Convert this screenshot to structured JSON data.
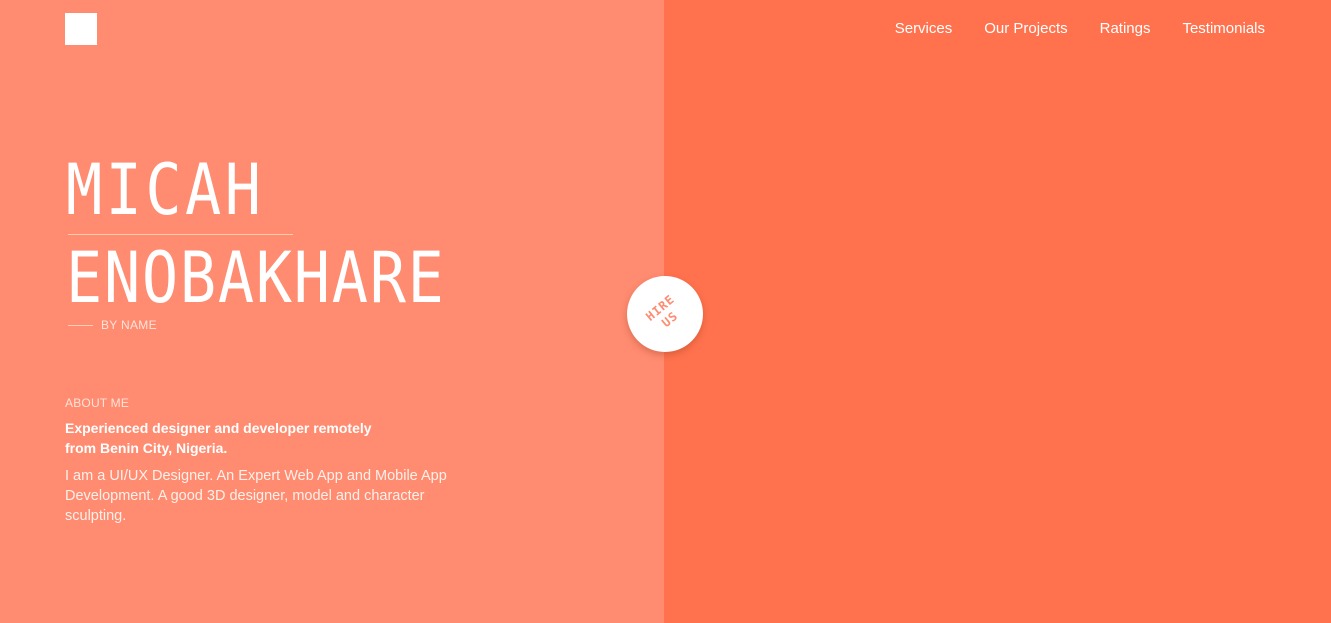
{
  "nav": {
    "items": [
      {
        "label": "Services"
      },
      {
        "label": "Our Projects"
      },
      {
        "label": "Ratings"
      },
      {
        "label": "Testimonials"
      }
    ]
  },
  "hero": {
    "first_name": "MICAH",
    "last_name": "ENOBAKHARE",
    "by_label": "BY NAME"
  },
  "about": {
    "heading": "ABOUT ME",
    "lead_line1": "Experienced designer and developer remotely",
    "lead_line2": "from Benin City, Nigeria.",
    "body": "I am a UI/UX Designer. An Expert Web App and Mobile App Development. A good 3D designer, model and character sculpting."
  },
  "cta": {
    "line1": "HIRE",
    "line2": "US"
  },
  "colors": {
    "left_panel": "#ff8b70",
    "right_panel": "#ff724d",
    "text": "#ffffff"
  }
}
